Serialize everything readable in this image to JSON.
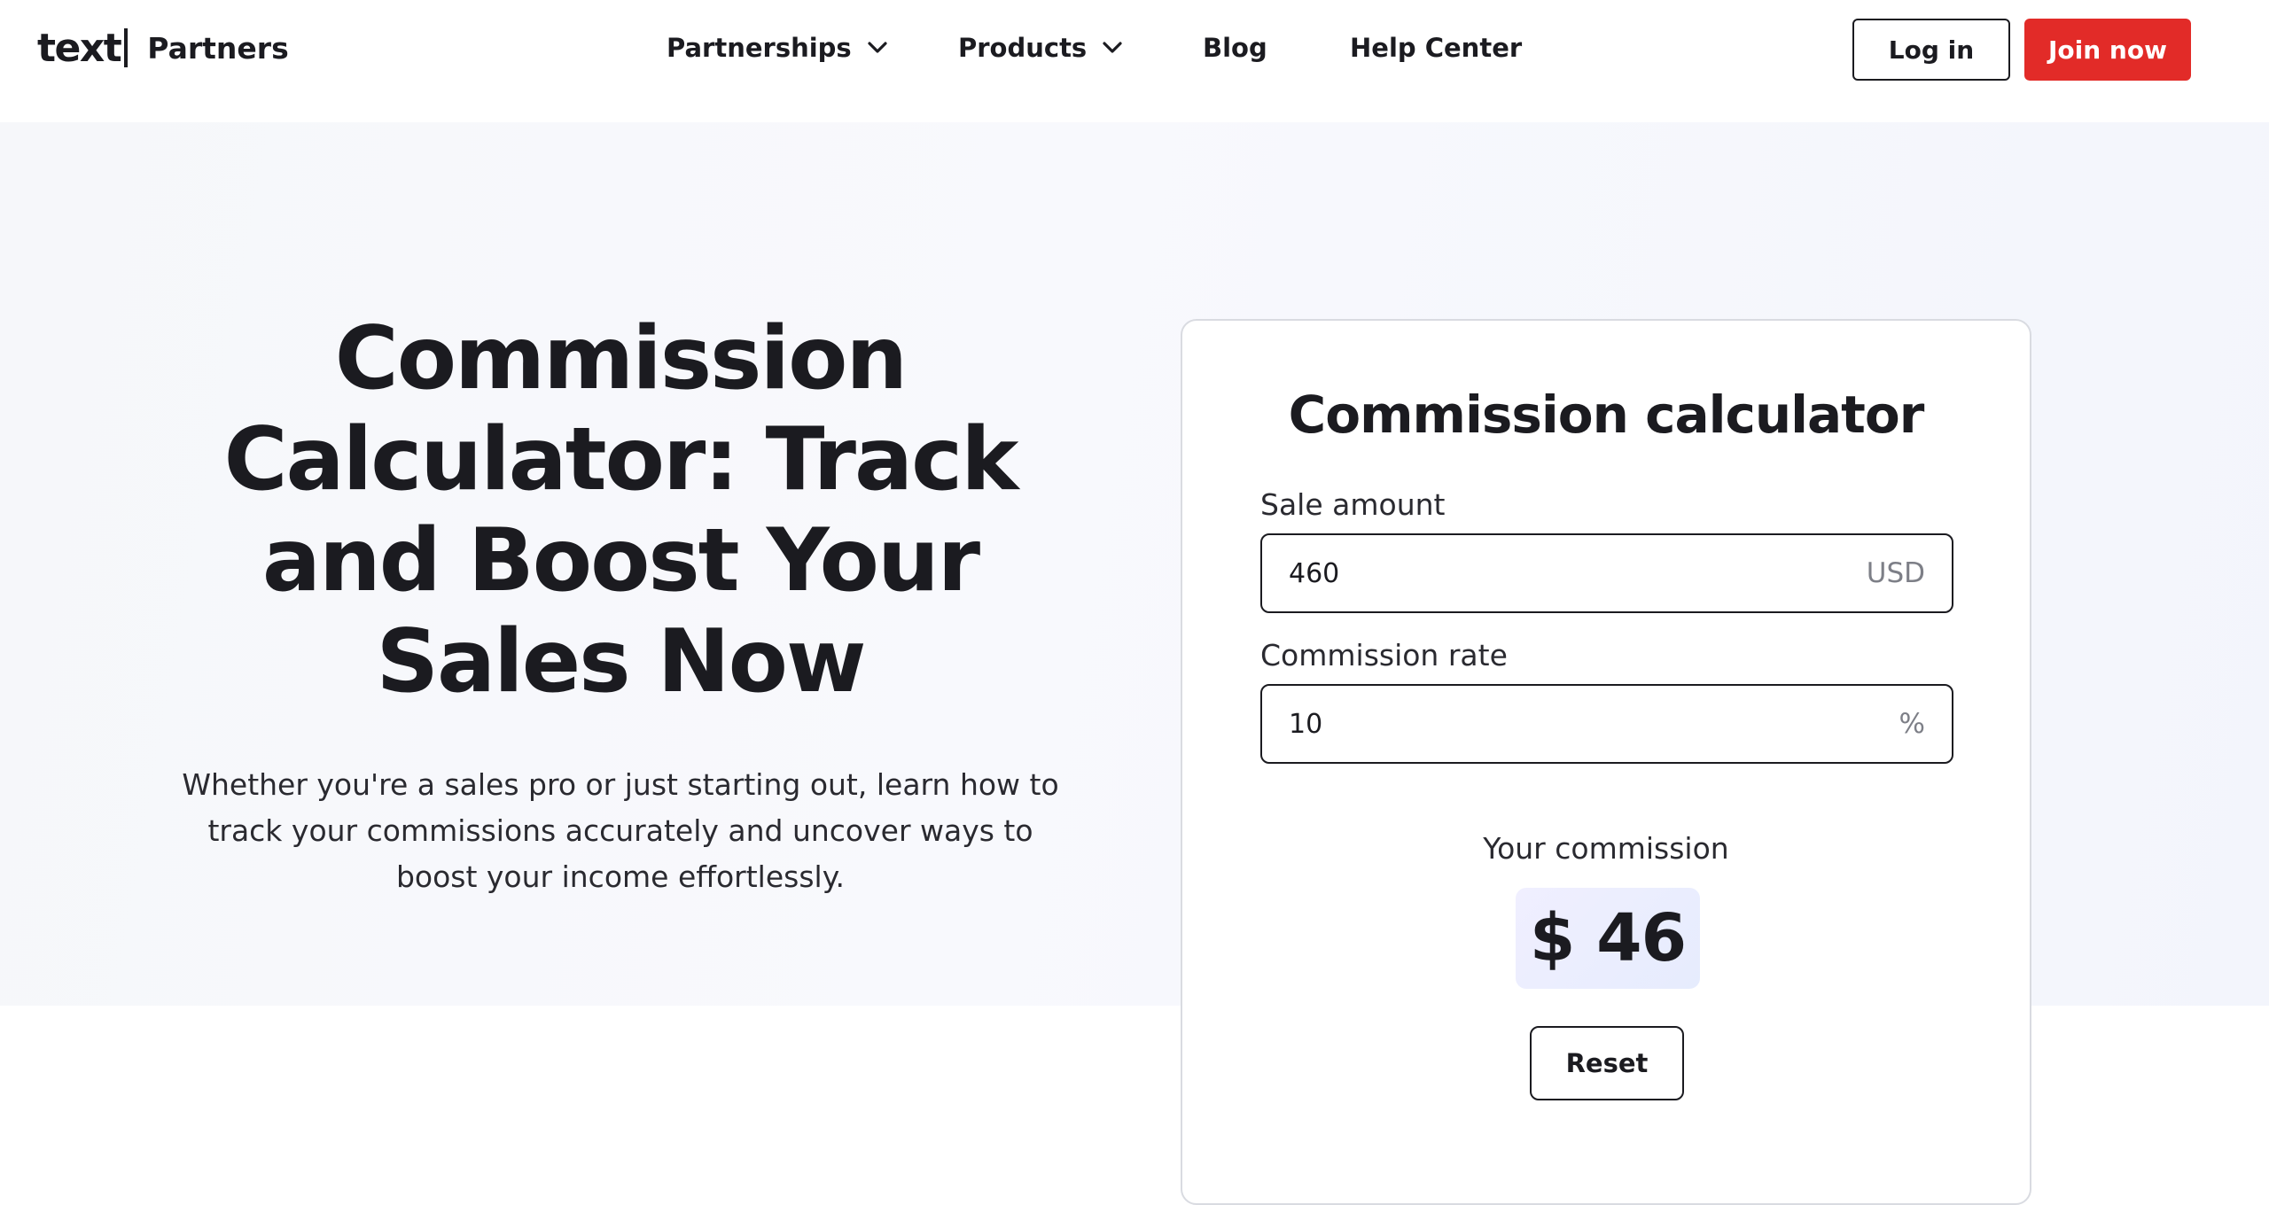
{
  "header": {
    "logo_text": "text",
    "logo_partners": "Partners",
    "nav": [
      {
        "label": "Partnerships",
        "has_dropdown": true
      },
      {
        "label": "Products",
        "has_dropdown": true
      },
      {
        "label": "Blog",
        "has_dropdown": false
      },
      {
        "label": "Help Center",
        "has_dropdown": false
      }
    ],
    "login_label": "Log in",
    "join_label": "Join now",
    "join_color": "#e22b28"
  },
  "hero": {
    "title": "Commission Calculator: Track and Boost Your Sales Now",
    "subtitle": "Whether you're a sales pro or just starting out, learn how to track your commissions accurately and uncover ways to boost your income effortlessly."
  },
  "calculator": {
    "title": "Commission calculator",
    "sale_amount_label": "Sale amount",
    "sale_amount_value": "460",
    "sale_amount_unit": "USD",
    "rate_label": "Commission rate",
    "rate_value": "10",
    "rate_unit": "%",
    "result_label": "Your commission",
    "result_value": "$ 46",
    "reset_label": "Reset"
  }
}
